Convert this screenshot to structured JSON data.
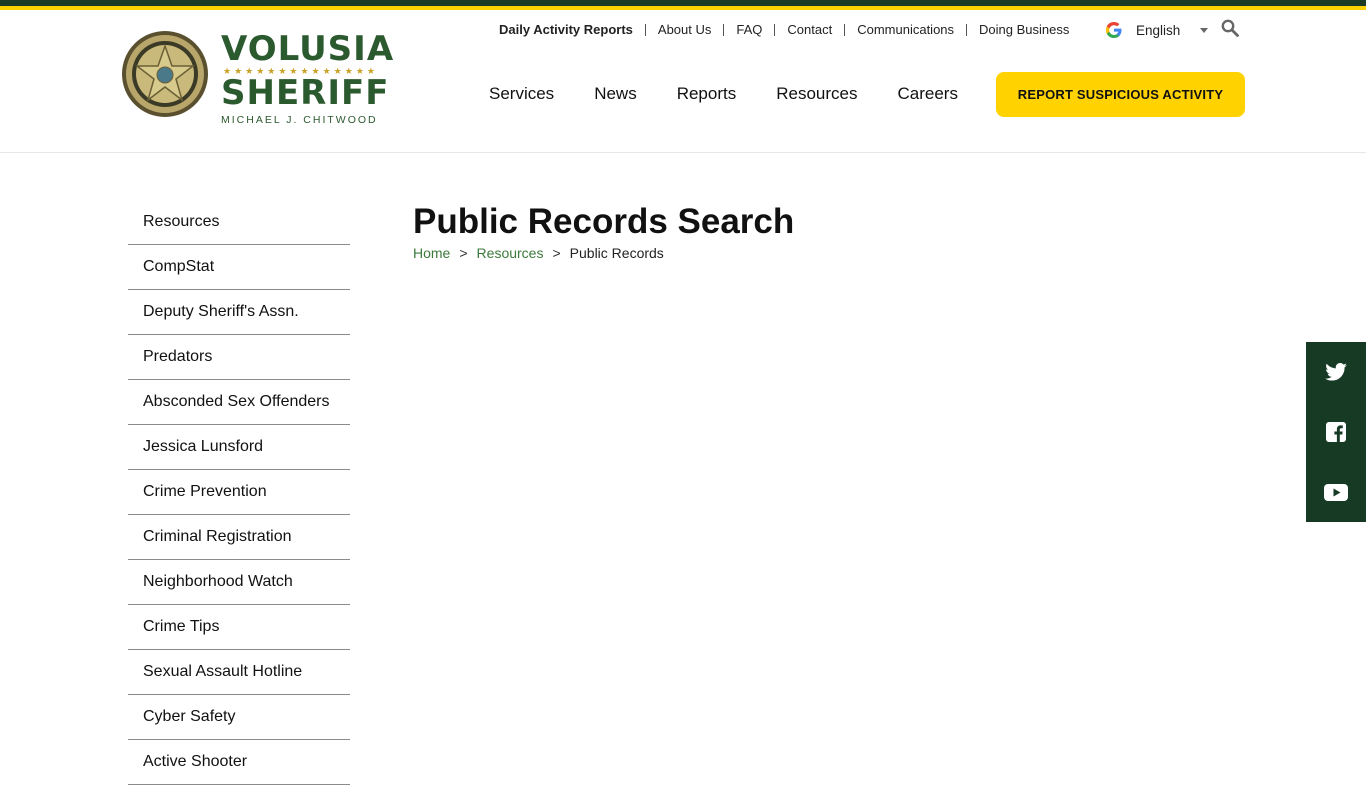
{
  "site": {
    "logo": {
      "line1": "VOLUSIA",
      "line2": "SHERIFF",
      "stars": "★★★★★★★★★★★★★★",
      "name": "MICHAEL J. CHITWOOD"
    }
  },
  "utility_nav": [
    {
      "label": "Daily Activity Reports"
    },
    {
      "label": "About Us"
    },
    {
      "label": "FAQ"
    },
    {
      "label": "Contact"
    },
    {
      "label": "Communications"
    },
    {
      "label": "Doing Business"
    }
  ],
  "language": {
    "selected": "English"
  },
  "main_nav": [
    {
      "label": "Services"
    },
    {
      "label": "News"
    },
    {
      "label": "Reports"
    },
    {
      "label": "Resources"
    },
    {
      "label": "Careers"
    }
  ],
  "cta": {
    "label": "REPORT SUSPICIOUS ACTIVITY"
  },
  "sidebar": {
    "items": [
      {
        "label": "Resources"
      },
      {
        "label": "CompStat"
      },
      {
        "label": "Deputy Sheriff's Assn."
      },
      {
        "label": "Predators"
      },
      {
        "label": "Absconded Sex Offenders"
      },
      {
        "label": "Jessica Lunsford"
      },
      {
        "label": "Crime Prevention"
      },
      {
        "label": "Criminal Registration"
      },
      {
        "label": "Neighborhood Watch"
      },
      {
        "label": "Crime Tips"
      },
      {
        "label": "Sexual Assault Hotline"
      },
      {
        "label": "Cyber Safety"
      },
      {
        "label": "Active Shooter"
      }
    ]
  },
  "page": {
    "title": "Public Records Search",
    "breadcrumb": {
      "home": "Home",
      "section": "Resources",
      "current": "Public Records",
      "separator": ">"
    }
  },
  "social": [
    "twitter-icon",
    "facebook-icon",
    "youtube-icon"
  ],
  "colors": {
    "brand_green": "#2c5a2f",
    "dark_green": "#173a24",
    "accent_yellow": "#ffd200",
    "link_green": "#3c7a3c"
  }
}
